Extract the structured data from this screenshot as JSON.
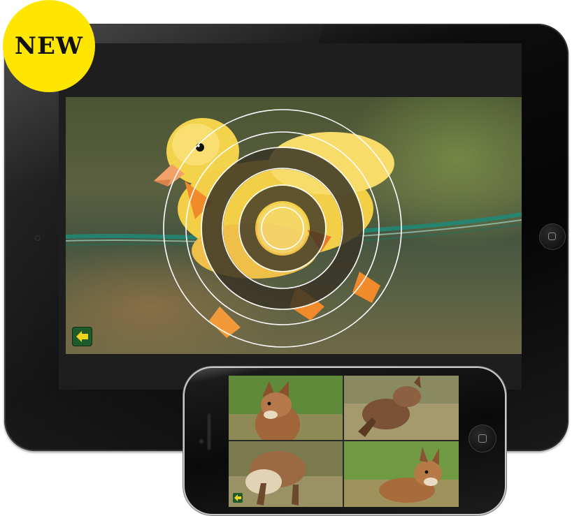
{
  "badge": {
    "label": "NEW",
    "color": "#ffe600"
  },
  "tablet": {
    "puzzle_image": "duckling",
    "back_icon": "arrow-left-icon",
    "home_icon": "home-button-icon"
  },
  "phone": {
    "puzzle_image": "fox cub",
    "back_icon": "arrow-left-icon",
    "home_icon": "home-button-icon",
    "tiles": [
      "fox-tile-top-left",
      "fox-tile-top-right",
      "fox-tile-bottom-left",
      "fox-tile-bottom-right"
    ]
  },
  "colors": {
    "button_green": "#1f5a2a",
    "arrow_yellow": "#f2d21b",
    "ring_line": "#ffffff"
  }
}
